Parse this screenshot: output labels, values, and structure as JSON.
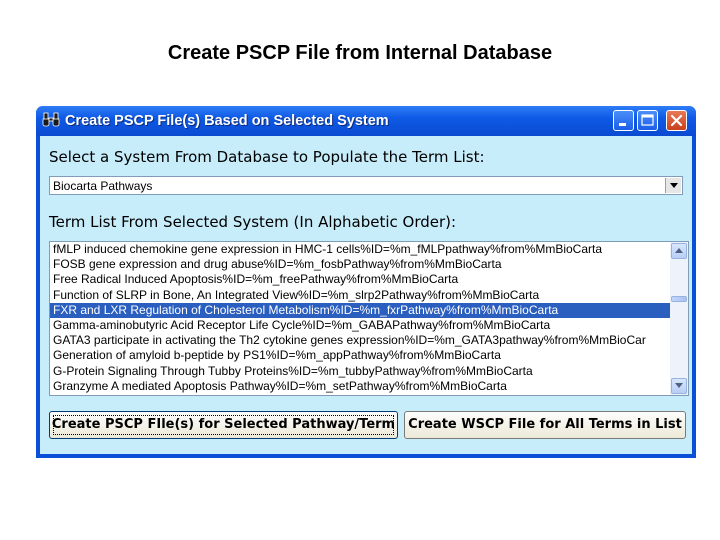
{
  "slide": {
    "title": "Create PSCP File from Internal Database"
  },
  "window": {
    "title": "Create PSCP File(s)  Based on Selected System",
    "icon": "binoculars-icon",
    "controls": [
      "minimize-icon",
      "maximize-icon",
      "close-icon"
    ]
  },
  "system_section": {
    "label": "Select a System From Database to Populate the Term List:",
    "selected": "Biocarta Pathways"
  },
  "term_section": {
    "label": "Term List From Selected System (In Alphabetic Order):",
    "items": [
      "fMLP induced chemokine gene expression in HMC-1 cells%ID=%m_fMLPpathway%from%MmBioCarta",
      "FOSB gene expression and drug abuse%ID=%m_fosbPathway%from%MmBioCarta",
      "Free Radical Induced Apoptosis%ID=%m_freePathway%from%MmBioCarta",
      "Function of SLRP in Bone, An Integrated View%ID=%m_slrp2Pathway%from%MmBioCarta",
      "FXR and LXR Regulation of Cholesterol Metabolism%ID=%m_fxrPathway%from%MmBioCarta",
      "Gamma-aminobutyric Acid Receptor Life Cycle%ID=%m_GABAPathway%from%MmBioCarta",
      "GATA3 participate in activating the Th2 cytokine genes expression%ID=%m_GATA3pathway%from%MmBioCar",
      "Generation of amyloid b-peptide by PS1%ID=%m_appPathway%from%MmBioCarta",
      "G-Protein Signaling Through Tubby Proteins%ID=%m_tubbyPathway%from%MmBioCarta",
      "Granzyme A mediated Apoptosis Pathway%ID=%m_setPathway%from%MmBioCarta"
    ],
    "selected_index": 4
  },
  "buttons": {
    "create_pscp": "Create PSCP FIle(s) for Selected Pathway/Term",
    "create_wscp": "Create WSCP File for All Terms in List"
  },
  "colors": {
    "title_bar": "#0a4fd8",
    "client_bg": "#c7edfb",
    "selection": "#2a5ebf"
  }
}
